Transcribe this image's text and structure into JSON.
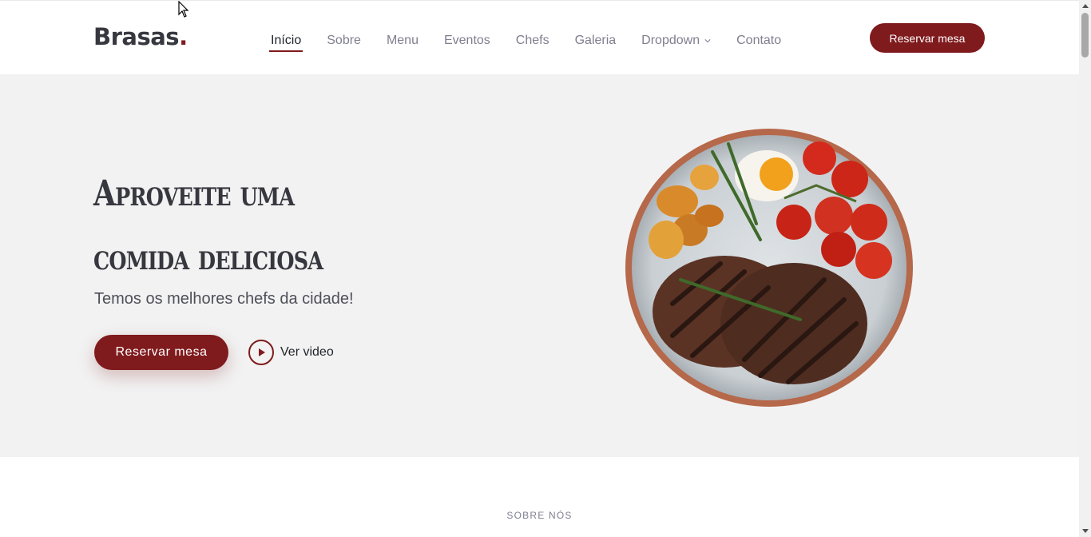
{
  "header": {
    "logo_text": "Brasas",
    "logo_dot": ".",
    "nav": [
      {
        "label": "Início",
        "active": true
      },
      {
        "label": "Sobre"
      },
      {
        "label": "Menu"
      },
      {
        "label": "Eventos"
      },
      {
        "label": "Chefs"
      },
      {
        "label": "Galeria"
      },
      {
        "label": "Dropdown",
        "has_dropdown": true
      },
      {
        "label": "Contato"
      }
    ],
    "cta_label": "Reservar mesa"
  },
  "hero": {
    "title_line1": "Aproveite uma",
    "title_line2": "comida deliciosa",
    "subtitle": "Temos os melhores chefs da cidade!",
    "cta_label": "Reservar mesa",
    "video_label": "Ver video",
    "image_icon": "steak-plate-image"
  },
  "about": {
    "section_tag": "SOBRE NÓS"
  },
  "colors": {
    "accent": "#7f1a1d",
    "hero_bg": "#f2f2f2",
    "text_dark": "#37373f",
    "nav_text": "#7f7f90"
  }
}
